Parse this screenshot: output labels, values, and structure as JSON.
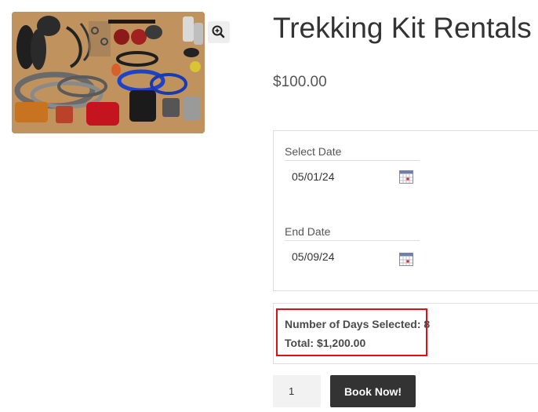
{
  "product": {
    "title": "Trekking Kit Rentals",
    "price": "$100.00",
    "image_icon": "trekking-gear-photo",
    "zoom_icon": "magnifier-plus-icon"
  },
  "booking": {
    "start_label": "Select Date",
    "start_value": "05/01/24",
    "end_label": "End Date",
    "end_value": "05/09/24",
    "calendar_icon": "calendar-icon"
  },
  "summary": {
    "days_text": "Number of Days Selected: 8",
    "total_text": "Total: $1,200.00",
    "highlight_color": "#e01010"
  },
  "cart": {
    "quantity": "1",
    "book_label": "Book Now!"
  }
}
